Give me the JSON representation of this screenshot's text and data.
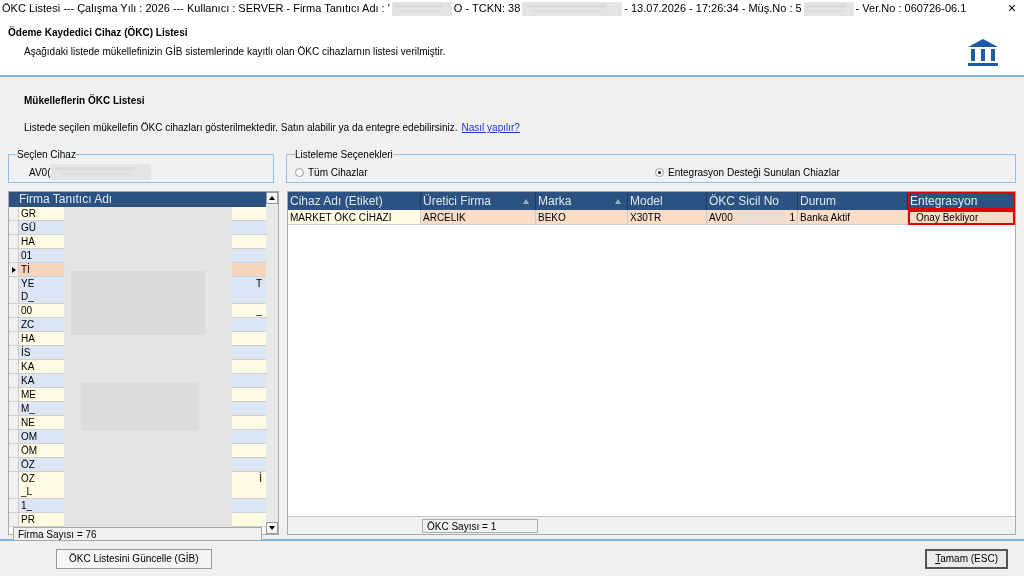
{
  "window": {
    "title_parts": [
      "ÖKC Listesi  ---  Çalışma Yılı : 2026  ---  Kullanıcı : SERVER - Firma Tanıtıcı Adı : '",
      "O - TCKN: 38",
      "- 13.07.2026 - 17:26:34 - Müş.No : 5",
      "- Ver.No : 060726-06.1"
    ],
    "close": "×"
  },
  "header": {
    "title": "Ödeme Kaydedici Cihaz (ÖKC) Listesi",
    "subtitle": "Aşağıdaki listede mükellefinizin GİB sistemlerinde kayıtlı olan ÖKC cihazlarnın listesi verilmiştir."
  },
  "section": {
    "title": "Mükelleflerin ÖKC Listesi",
    "description": "Listede seçilen mükellefin ÖKC cihazları gösterilmektedir. Satın alabilir ya da entegre edebilirsiniz.",
    "link": "Nasıl yapılır?"
  },
  "selected_device": {
    "label": "Seçlen Cihaz",
    "value": "AV0("
  },
  "listing_options": {
    "label": "Listeleme Seçenekleri",
    "options": [
      {
        "label": "Tüm Cihazlar",
        "selected": false
      },
      {
        "label": "Entegrasyon Desteği Sunulan Chiazlar",
        "selected": true
      }
    ]
  },
  "firm_list": {
    "column": "Firma Tanıtıcı Adı",
    "rows": [
      {
        "lines": [
          "GR"
        ],
        "selected": false
      },
      {
        "lines": [
          "GÜ"
        ],
        "selected": false
      },
      {
        "lines": [
          "HA"
        ],
        "selected": false
      },
      {
        "lines": [
          "01"
        ],
        "selected": false
      },
      {
        "lines": [
          "Tİ"
        ],
        "selected": true
      },
      {
        "lines": [
          "YE",
          "D_"
        ],
        "tail": "T",
        "selected": false
      },
      {
        "lines": [
          "00"
        ],
        "tail": "_",
        "selected": false
      },
      {
        "lines": [
          "ZC"
        ],
        "selected": false
      },
      {
        "lines": [
          "HA"
        ],
        "selected": false
      },
      {
        "lines": [
          "İS"
        ],
        "selected": false
      },
      {
        "lines": [
          "KA"
        ],
        "selected": false
      },
      {
        "lines": [
          "KA"
        ],
        "selected": false
      },
      {
        "lines": [
          "ME"
        ],
        "selected": false
      },
      {
        "lines": [
          "M_"
        ],
        "selected": false
      },
      {
        "lines": [
          "NE"
        ],
        "selected": false
      },
      {
        "lines": [
          "OM"
        ],
        "selected": false
      },
      {
        "lines": [
          "ÖM"
        ],
        "selected": false
      },
      {
        "lines": [
          "ÖZ"
        ],
        "selected": false
      },
      {
        "lines": [
          "ÖZ",
          "_L"
        ],
        "tail": "İ",
        "selected": false
      },
      {
        "lines": [
          "1_"
        ],
        "selected": false
      },
      {
        "lines": [
          "PR"
        ],
        "selected": false
      }
    ],
    "footer": "Firma Sayısı = 76"
  },
  "device_table": {
    "columns": [
      {
        "label": "Cihaz Adı (Etiket)",
        "sortable": false
      },
      {
        "label": "Üretici Firma",
        "sortable": true
      },
      {
        "label": "Marka",
        "sortable": true
      },
      {
        "label": "Model",
        "sortable": false
      },
      {
        "label": "ÖKC Sicil No",
        "sortable": false
      },
      {
        "label": "Durum",
        "sortable": false
      },
      {
        "label": "Entegrasyon",
        "sortable": false,
        "highlighted": true
      }
    ],
    "rows": [
      {
        "cells": [
          "MARKET ÖKC CİHAZI",
          "ARCELIK",
          "BEKO",
          "X30TR",
          [
            "AV00",
            "1"
          ],
          "Banka Aktif",
          "Onay Bekliyor"
        ]
      }
    ],
    "footer": "ÖKC Sayısı = 1"
  },
  "buttons": {
    "update": "ÖKC Listesini Güncelle (GİB)",
    "ok": {
      "mnemonic": "T",
      "rest": "amam (ESC)"
    }
  }
}
